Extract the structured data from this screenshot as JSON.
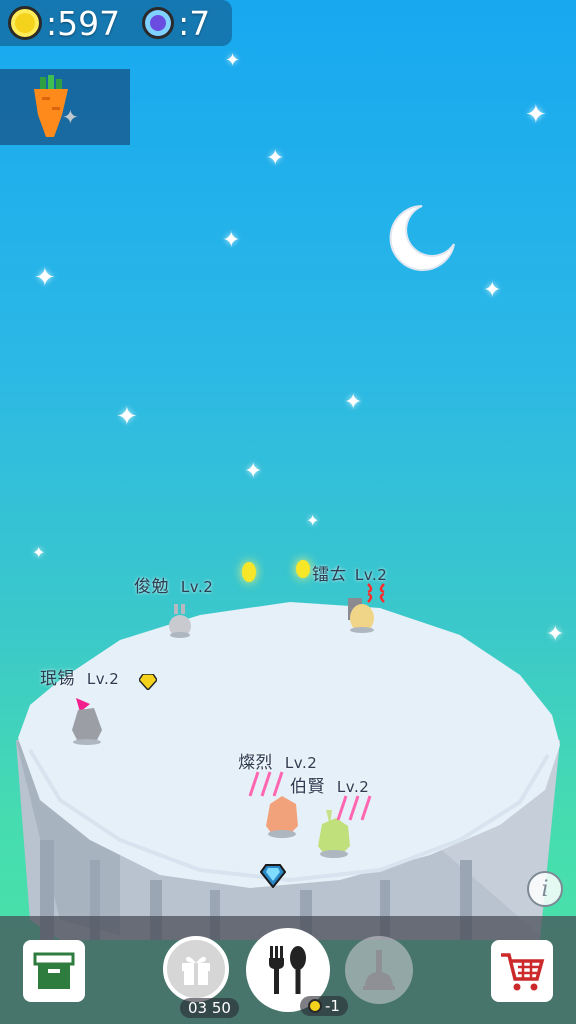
{
  "hud": {
    "coins": ":597",
    "gems": ":7",
    "coin_color": "#f5d31c",
    "gem_color": "#6a4ce0"
  },
  "item_panel": {
    "icon": "carrot-icon"
  },
  "rabbits": [
    {
      "name": "俊勉",
      "level": "Lv.2"
    },
    {
      "name": "镭ㄊ",
      "level": "Lv.2"
    },
    {
      "name": "珉锡",
      "level": "Lv.2"
    },
    {
      "name": "燦烈",
      "level": "Lv.2"
    },
    {
      "name": "伯賢",
      "level": "Lv.2"
    }
  ],
  "toolbar": {
    "storage": {
      "icon": "storage-box-icon"
    },
    "gift": {
      "icon": "gift-icon",
      "timer": "03 50"
    },
    "feed": {
      "icon": "fork-spoon-icon",
      "cost": "-1"
    },
    "clean": {
      "icon": "plunger-icon"
    },
    "shop": {
      "icon": "cart-icon"
    },
    "info": {
      "label": "i"
    }
  }
}
